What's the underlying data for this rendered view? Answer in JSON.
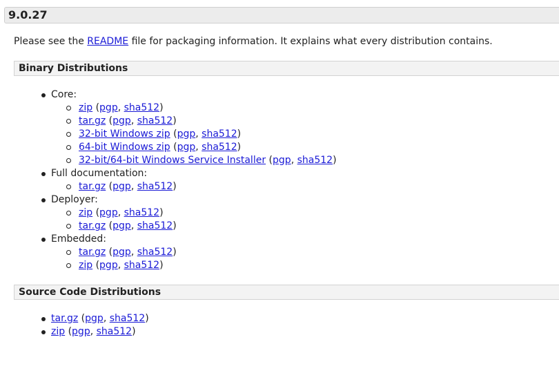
{
  "version": "9.0.27",
  "intro": {
    "before": "Please see the ",
    "link": "README",
    "after": " file for packaging information. It explains what every distribution contains."
  },
  "binary": {
    "title": "Binary Distributions",
    "groups": [
      {
        "label": "Core:",
        "items": [
          {
            "name": "zip",
            "sig": "pgp",
            "hash": "sha512"
          },
          {
            "name": "tar.gz",
            "sig": "pgp",
            "hash": "sha512"
          },
          {
            "name": "32-bit Windows zip",
            "sig": "pgp",
            "hash": "sha512"
          },
          {
            "name": "64-bit Windows zip",
            "sig": "pgp",
            "hash": "sha512"
          },
          {
            "name": "32-bit/64-bit Windows Service Installer",
            "sig": "pgp",
            "hash": "sha512"
          }
        ]
      },
      {
        "label": "Full documentation:",
        "items": [
          {
            "name": "tar.gz",
            "sig": "pgp",
            "hash": "sha512"
          }
        ]
      },
      {
        "label": "Deployer:",
        "items": [
          {
            "name": "zip",
            "sig": "pgp",
            "hash": "sha512"
          },
          {
            "name": "tar.gz",
            "sig": "pgp",
            "hash": "sha512"
          }
        ]
      },
      {
        "label": "Embedded:",
        "items": [
          {
            "name": "tar.gz",
            "sig": "pgp",
            "hash": "sha512"
          },
          {
            "name": "zip",
            "sig": "pgp",
            "hash": "sha512"
          }
        ]
      }
    ]
  },
  "source": {
    "title": "Source Code Distributions",
    "items": [
      {
        "name": "tar.gz",
        "sig": "pgp",
        "hash": "sha512"
      },
      {
        "name": "zip",
        "sig": "pgp",
        "hash": "sha512"
      }
    ]
  },
  "punct": {
    "open": " (",
    "sep": ", ",
    "close": ")"
  }
}
